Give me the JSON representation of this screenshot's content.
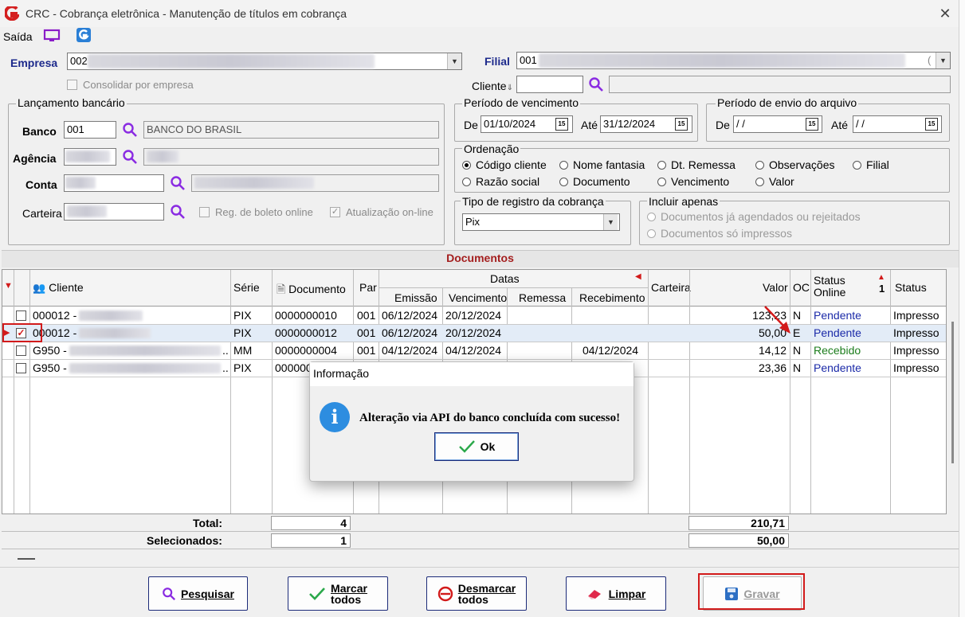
{
  "window": {
    "title": "CRC - Cobrança eletrônica - Manutenção de títulos em cobrança",
    "close": "✕"
  },
  "menu": {
    "saida": "Saída"
  },
  "empresa": {
    "label": "Empresa",
    "code": "002",
    "consolidar": "Consolidar por empresa"
  },
  "filial": {
    "label": "Filial",
    "code": "001",
    "suffix": "("
  },
  "cliente": {
    "label": "Cliente",
    "arrow": "⇓"
  },
  "lancamento": {
    "title": "Lançamento bancário",
    "banco_label": "Banco",
    "banco_code": "001",
    "banco_name": "BANCO DO BRASIL",
    "agencia_label": "Agência",
    "conta_label": "Conta",
    "carteira_label": "Carteira",
    "reg_boleto": "Reg. de boleto online",
    "atualizacao": "Atualização on-line"
  },
  "vencimento": {
    "title": "Período de vencimento",
    "de_label": "De",
    "de": "01/10/2024",
    "ate_label": "Até",
    "ate": "31/12/2024"
  },
  "envio": {
    "title": "Período de envio do arquivo",
    "de_label": "De",
    "de": " / /",
    "ate_label": "Até",
    "ate": " / /"
  },
  "cal_icon": "15",
  "ordenacao": {
    "title": "Ordenação",
    "options": [
      "Código cliente",
      "Nome fantasia",
      "Dt. Remessa",
      "Observações",
      "Filial",
      "Razão social",
      "Documento",
      "Vencimento",
      "Valor"
    ]
  },
  "tipo_registro": {
    "title": "Tipo de registro da cobrança",
    "value": "Pix"
  },
  "incluir": {
    "title": "Incluir apenas",
    "opt1": "Documentos já agendados ou rejeitados",
    "opt2": "Documentos só impressos"
  },
  "documentos": {
    "title": "Documentos",
    "headers": {
      "cliente": "Cliente",
      "serie": "Série",
      "documento": "Documento",
      "par": "Par",
      "datas": "Datas",
      "emissao": "Emissão",
      "vencimento": "Vencimento",
      "remessa": "Remessa",
      "recebimento": "Recebimento",
      "carteira": "Carteira",
      "valor": "Valor",
      "oc": "OC",
      "status_online": "Status Online",
      "status": "Status",
      "sort_num": "1"
    },
    "rows": [
      {
        "cliente": "000012 -",
        "serie": "PIX",
        "documento": "0000000010",
        "par": "001",
        "emissao": "06/12/2024",
        "vencimento": "20/12/2024",
        "remessa": "",
        "recebimento": "",
        "valor": "123,23",
        "oc": "N",
        "status_online": "Pendente",
        "status": "Impresso"
      },
      {
        "cliente": "000012 -",
        "serie": "PIX",
        "documento": "0000000012",
        "par": "001",
        "emissao": "06/12/2024",
        "vencimento": "20/12/2024",
        "remessa": "",
        "recebimento": "",
        "valor": "50,00",
        "oc": "E",
        "status_online": "Pendente",
        "status": "Impresso"
      },
      {
        "cliente": "G950 -",
        "serie": "MM",
        "documento": "0000000004",
        "par": "001",
        "emissao": "04/12/2024",
        "vencimento": "04/12/2024",
        "remessa": "",
        "recebimento": "04/12/2024",
        "valor": "14,12",
        "oc": "N",
        "status_online": "Recebido",
        "status": "Impresso"
      },
      {
        "cliente": "G950 -",
        "serie": "PIX",
        "documento": "000000",
        "par": "",
        "emissao": "",
        "vencimento": "",
        "remessa": "",
        "recebimento": "",
        "valor": "23,36",
        "oc": "N",
        "status_online": "Pendente",
        "status": "Impresso"
      }
    ],
    "row_ellipsis": ".."
  },
  "totals": {
    "total_label": "Total:",
    "total_count": "4",
    "total_value": "210,71",
    "sel_label": "Selecionados:",
    "sel_count": "1",
    "sel_value": "50,00"
  },
  "buttons": {
    "pesquisar": "Pesquisar",
    "marcar_1": "Marcar",
    "marcar_2": "todos",
    "desmarcar_1": "Desmarcar",
    "desmarcar_2": "todos",
    "limpar": "Limpar",
    "gravar": "Gravar"
  },
  "dialog": {
    "title": "Informação",
    "icon": "i",
    "message": "Alteração via API do banco concluída com sucesso!",
    "ok": "Ok"
  },
  "colors": {
    "accent": "#1d2a8c",
    "header_red": "#a41e1e",
    "highlight": "#d21a1a"
  }
}
